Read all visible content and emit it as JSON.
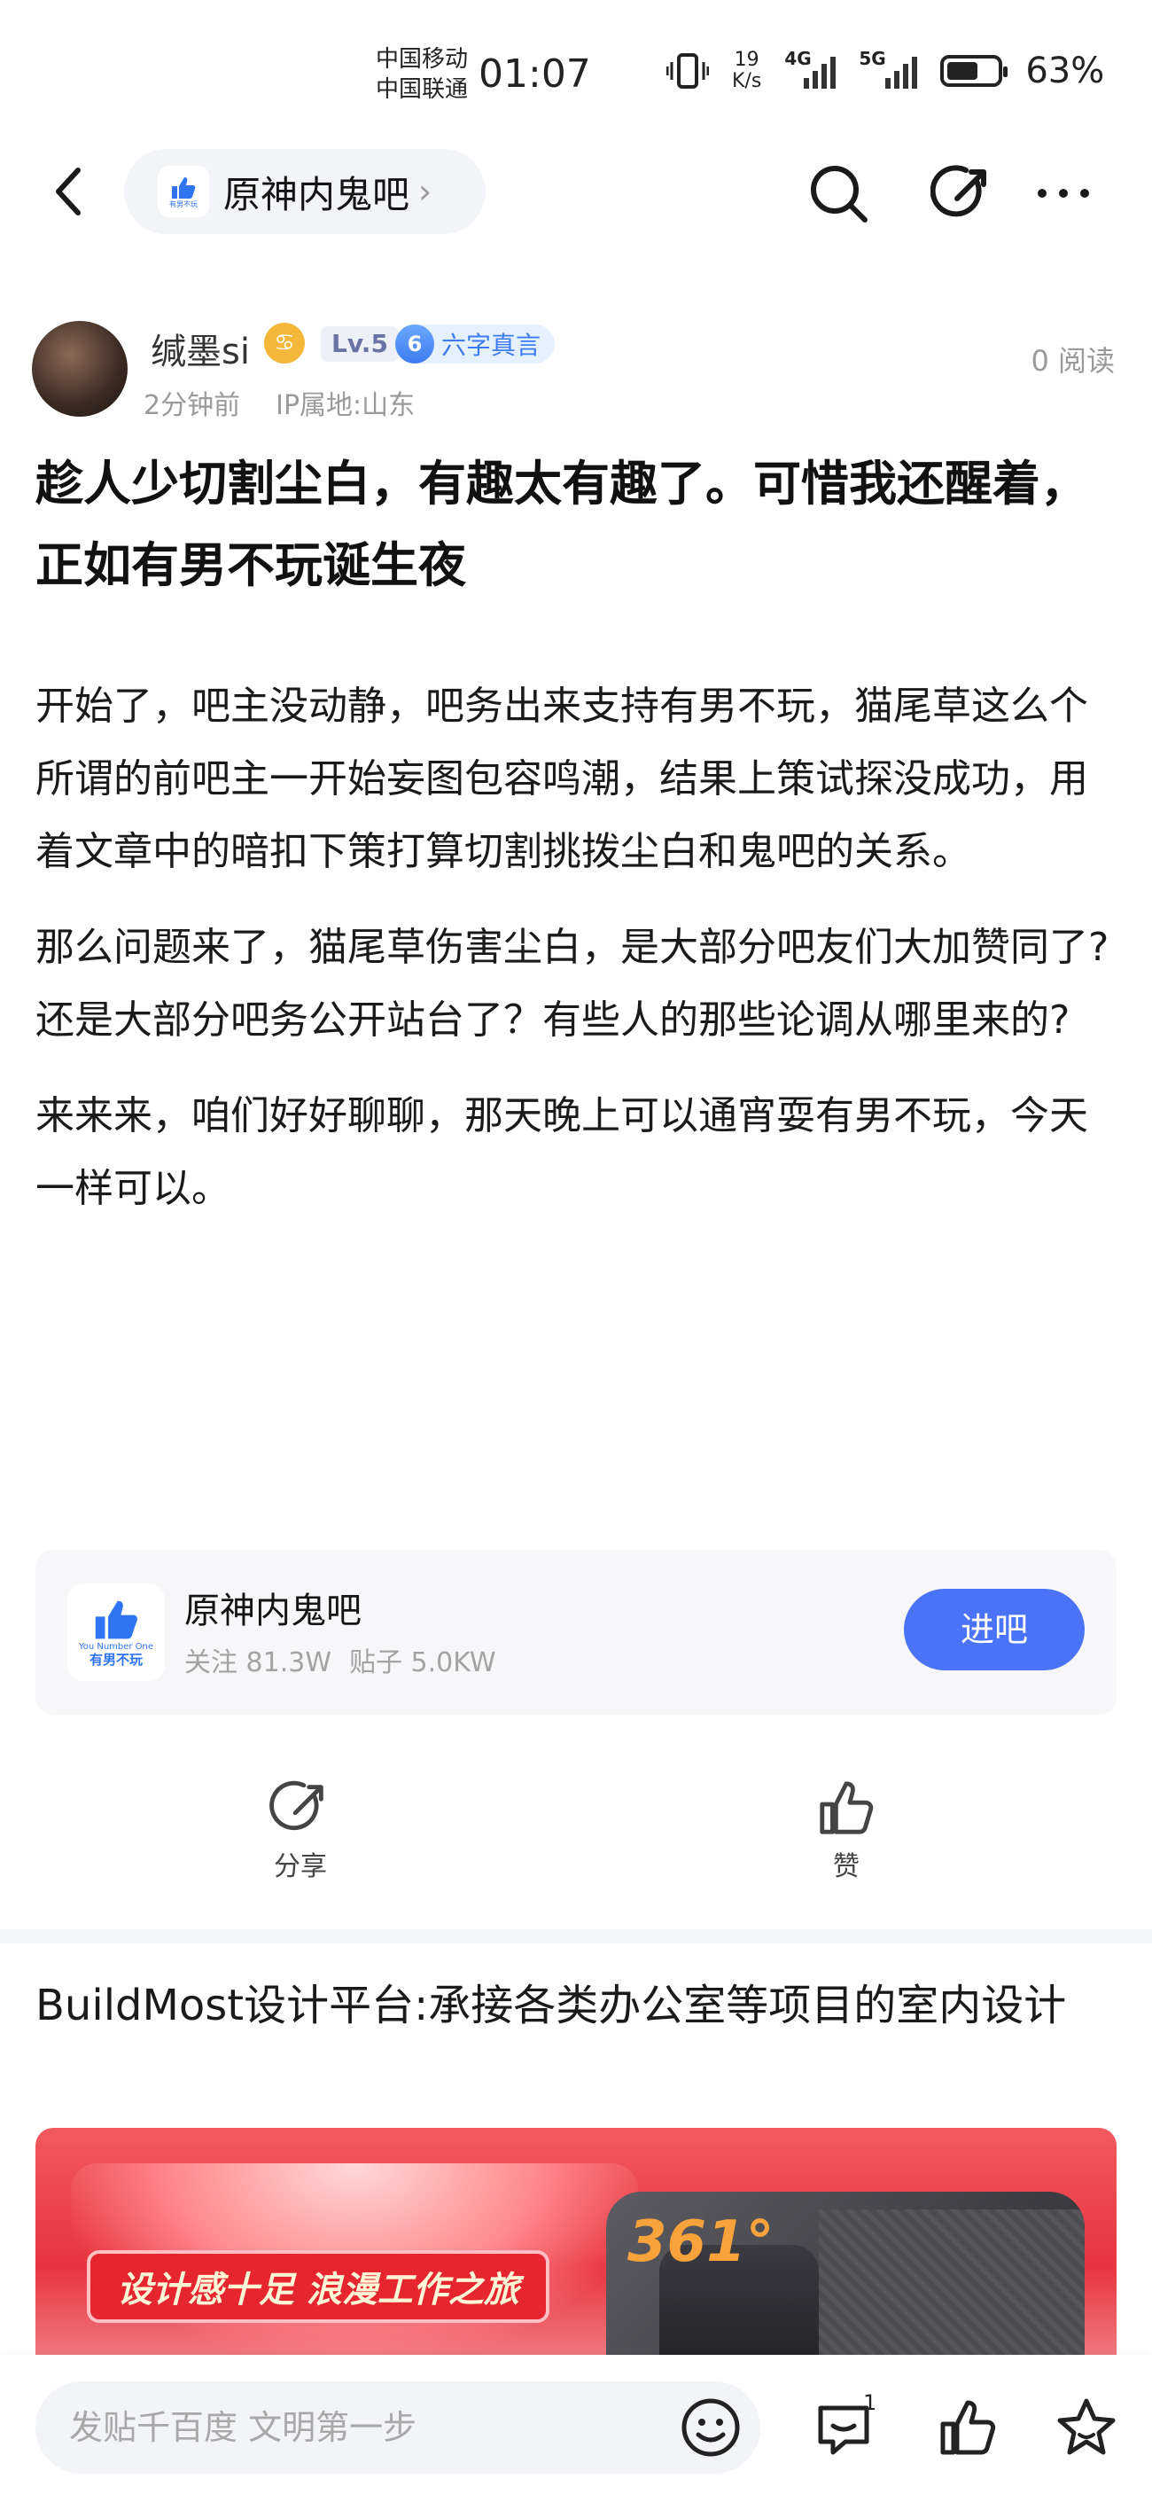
{
  "status_bar": {
    "carrier1": "中国移动",
    "carrier2": "中国联通",
    "time": "01:07",
    "net_speed_value": "19",
    "net_speed_unit": "K/s",
    "sim1": "4G",
    "sim2": "5G",
    "battery_level": 0.63,
    "battery_text": "63%"
  },
  "nav": {
    "forum_name": "原神内鬼吧",
    "chevron": "›"
  },
  "author": {
    "name": "缄墨si",
    "zodiac_glyph": "♋",
    "level": "Lv.5",
    "honor_level": "6",
    "honor_title": "六字真言",
    "time_ago": "2分钟前",
    "ip_location": "IP属地:山东",
    "reads": "0 阅读"
  },
  "post": {
    "title": "趁人少切割尘白，有趣太有趣了。可惜我还醒着，正如有男不玩诞生夜",
    "paragraphs": [
      "开始了，吧主没动静，吧务出来支持有男不玩，猫尾草这么个所谓的前吧主一开始妄图包容鸣潮，结果上策试探没成功，用着文章中的暗扣下策打算切割挑拨尘白和鬼吧的关系。",
      "那么问题来了，猫尾草伤害尘白，是大部分吧友们大加赞同了?还是大部分吧务公开站台了？有些人的那些论调从哪里来的?",
      "来来来，咱们好好聊聊，那天晚上可以通宵耍有男不玩，今天一样可以。"
    ]
  },
  "forum_card": {
    "name": "原神内鬼吧",
    "followers": "关注 81.3W",
    "posts": "贴子 5.0KW",
    "enter_label": "进吧",
    "logo_line1": "You Number One",
    "logo_line2": "有男不玩"
  },
  "actions": {
    "share_label": "分享",
    "like_label": "赞"
  },
  "ad": {
    "title": "BuildMost设计平台:承接各类办公室等项目的室内设计",
    "banner_text": "设计感十足 浪漫工作之旅",
    "brand": "361°"
  },
  "bottom_bar": {
    "reply_placeholder": "发贴千百度 文明第一步",
    "comment_count": "1"
  },
  "colors": {
    "accent": "#4a73f7",
    "honor_blue": "#3d7cf0",
    "meta_gray": "#9a9a9a",
    "card_bg": "#f7f7fa"
  }
}
